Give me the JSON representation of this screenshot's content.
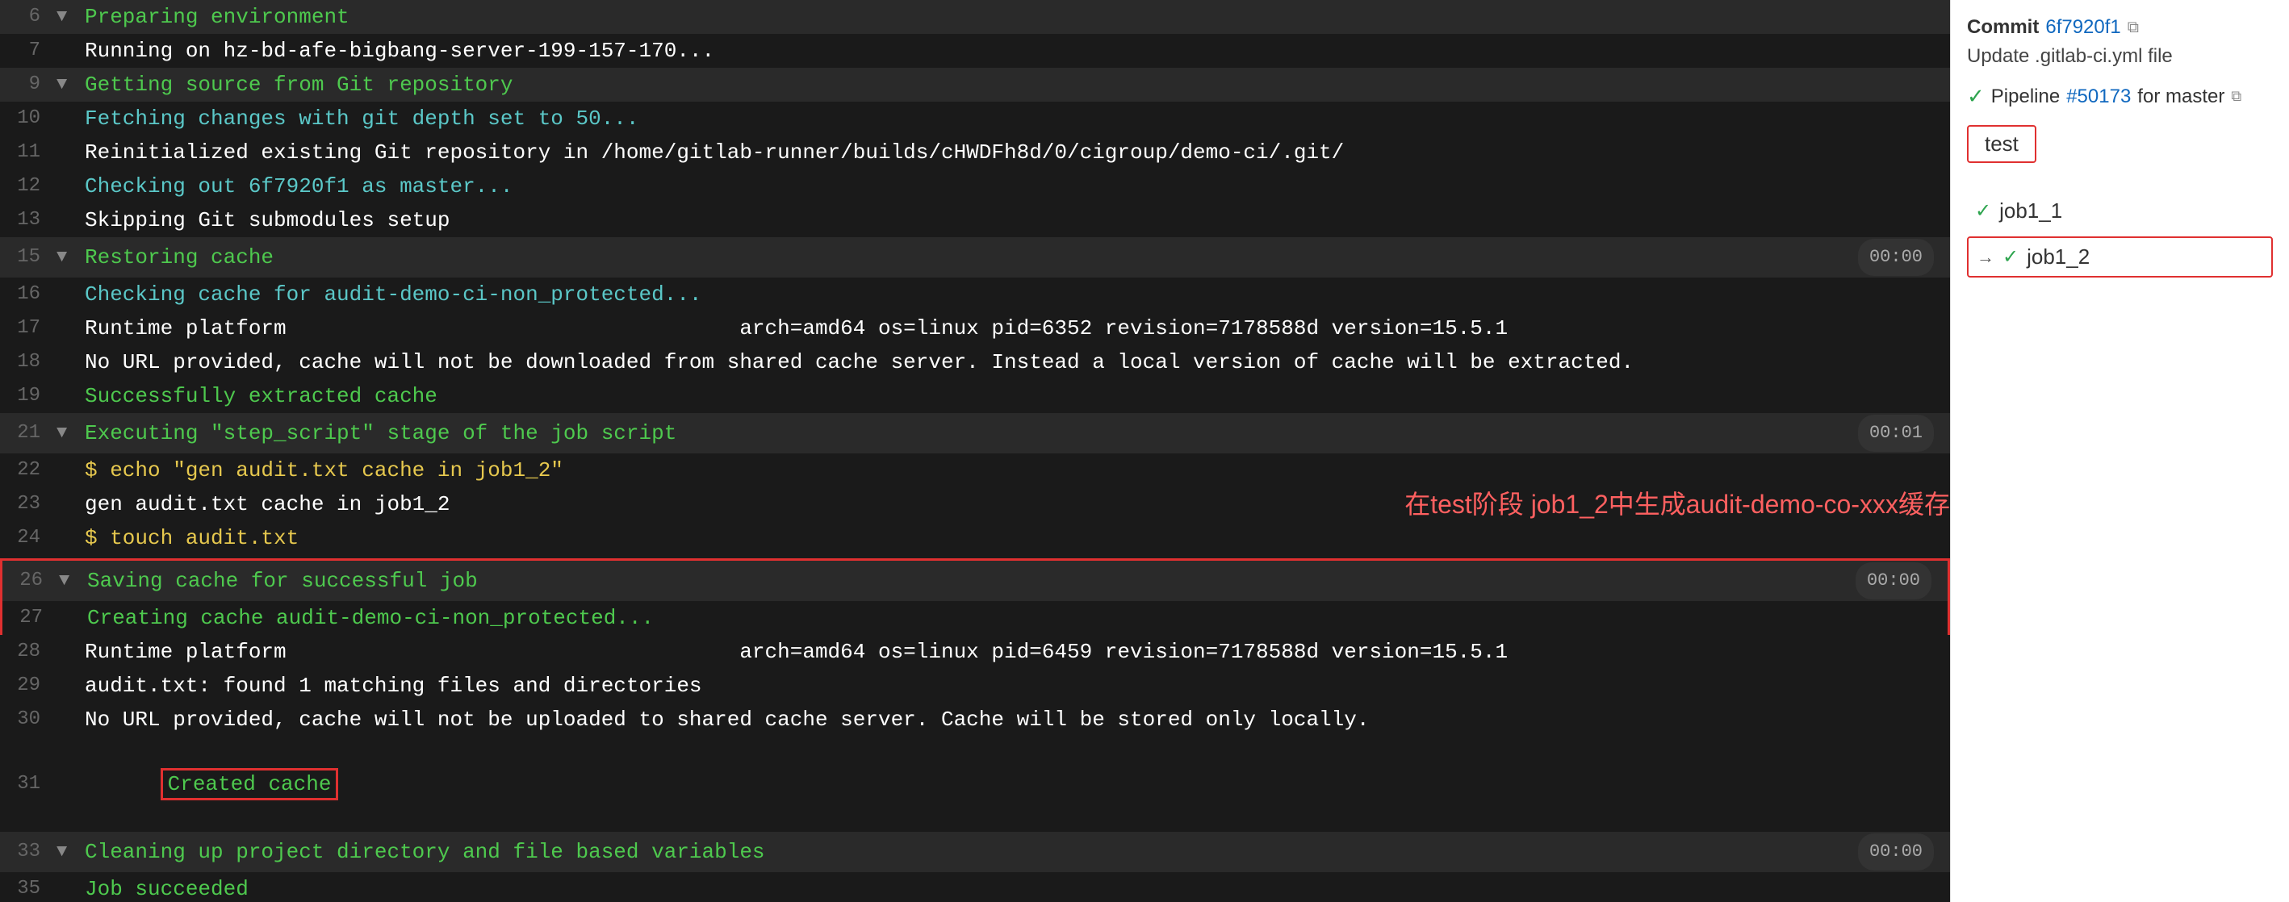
{
  "terminal": {
    "lines": [
      {
        "id": "6",
        "number": "6",
        "type": "section",
        "hasChevron": true,
        "chevronDir": "down",
        "content": "Preparing environment",
        "contentClass": "text-green",
        "timestamp": null
      },
      {
        "id": "7",
        "number": "7",
        "type": "normal",
        "hasChevron": false,
        "content": "Running on hz-bd-afe-bigbang-server-199-157-170...",
        "contentClass": "text-white",
        "timestamp": null
      },
      {
        "id": "9",
        "number": "9",
        "type": "section",
        "hasChevron": true,
        "chevronDir": "down",
        "content": "Getting source from Git repository",
        "contentClass": "text-green",
        "timestamp": null
      },
      {
        "id": "10",
        "number": "10",
        "type": "normal",
        "hasChevron": false,
        "content": "Fetching changes with git depth set to 50...",
        "contentClass": "text-cyan",
        "timestamp": null
      },
      {
        "id": "11",
        "number": "11",
        "type": "normal",
        "hasChevron": false,
        "content": "Reinitialized existing Git repository in /home/gitlab-runner/builds/cHWDFh8d/0/cigroup/demo-ci/.git/",
        "contentClass": "text-white",
        "timestamp": null
      },
      {
        "id": "12",
        "number": "12",
        "type": "normal",
        "hasChevron": false,
        "content": "Checking out 6f7920f1 as master...",
        "contentClass": "text-cyan",
        "timestamp": null
      },
      {
        "id": "13",
        "number": "13",
        "type": "normal",
        "hasChevron": false,
        "content": "Skipping Git submodules setup",
        "contentClass": "text-white",
        "timestamp": null
      },
      {
        "id": "15",
        "number": "15",
        "type": "section",
        "hasChevron": true,
        "chevronDir": "down",
        "content": "Restoring cache",
        "contentClass": "text-green",
        "timestamp": "00:00"
      },
      {
        "id": "16",
        "number": "16",
        "type": "normal",
        "hasChevron": false,
        "content": "Checking cache for audit-demo-ci-non_protected...",
        "contentClass": "text-cyan",
        "timestamp": null
      },
      {
        "id": "17",
        "number": "17",
        "type": "normal",
        "hasChevron": false,
        "content": "Runtime platform                                    arch=amd64 os=linux pid=6352 revision=7178588d version=15.5.1",
        "contentClass": "text-white",
        "timestamp": null
      },
      {
        "id": "18",
        "number": "18",
        "type": "normal",
        "hasChevron": false,
        "content": "No URL provided, cache will not be downloaded from shared cache server. Instead a local version of cache will be extracted.",
        "contentClass": "text-white",
        "timestamp": null
      },
      {
        "id": "19",
        "number": "19",
        "type": "normal",
        "hasChevron": false,
        "content": "Successfully extracted cache",
        "contentClass": "text-green",
        "timestamp": null
      },
      {
        "id": "21",
        "number": "21",
        "type": "section",
        "hasChevron": true,
        "chevronDir": "down",
        "content": "Executing \"step_script\" stage of the job script",
        "contentClass": "text-green",
        "timestamp": "00:01"
      },
      {
        "id": "22",
        "number": "22",
        "type": "normal",
        "hasChevron": false,
        "content": "$ echo \"gen audit.txt cache in job1_2\"",
        "contentClass": "text-yellow",
        "timestamp": null
      },
      {
        "id": "23",
        "number": "23",
        "type": "normal",
        "hasChevron": false,
        "content": "gen audit.txt cache in job1_2",
        "contentClass": "text-white",
        "timestamp": null
      },
      {
        "id": "24",
        "number": "24",
        "type": "normal",
        "hasChevron": false,
        "content": "$ touch audit.txt",
        "contentClass": "text-yellow",
        "timestamp": null
      },
      {
        "id": "26",
        "number": "26",
        "type": "section-box",
        "hasChevron": true,
        "chevronDir": "down",
        "content": "Saving cache for successful job",
        "contentClass": "text-green",
        "timestamp": "00:00",
        "boxed": true
      },
      {
        "id": "27",
        "number": "27",
        "type": "normal-box",
        "hasChevron": false,
        "content": "Creating cache audit-demo-ci-non_protected...",
        "contentClass": "text-green",
        "timestamp": null,
        "boxed": true
      },
      {
        "id": "28",
        "number": "28",
        "type": "normal",
        "hasChevron": false,
        "content": "Runtime platform                                    arch=amd64 os=linux pid=6459 revision=7178588d version=15.5.1",
        "contentClass": "text-white",
        "timestamp": null
      },
      {
        "id": "29",
        "number": "29",
        "type": "normal",
        "hasChevron": false,
        "content": "audit.txt: found 1 matching files and directories",
        "contentClass": "text-white",
        "timestamp": null
      },
      {
        "id": "30",
        "number": "30",
        "type": "normal",
        "hasChevron": false,
        "content": "No URL provided, cache will not be uploaded to shared cache server. Cache will be stored only locally.",
        "contentClass": "text-white",
        "timestamp": null
      },
      {
        "id": "31",
        "number": "31",
        "type": "normal-box",
        "hasChevron": false,
        "content": "Created cache",
        "contentClass": "text-green",
        "timestamp": null,
        "boxed": true
      },
      {
        "id": "33",
        "number": "33",
        "type": "section",
        "hasChevron": true,
        "chevronDir": "down",
        "content": "Cleaning up project directory and file based variables",
        "contentClass": "text-green",
        "timestamp": "00:00"
      },
      {
        "id": "35",
        "number": "35",
        "type": "normal",
        "hasChevron": false,
        "content": "Job succeeded",
        "contentClass": "text-green",
        "timestamp": null
      }
    ],
    "annotation": "在test阶段 job1_2中生成audit-demo-co-xxx缓存"
  },
  "sidebar": {
    "commit_label": "Commit",
    "commit_hash": "6f7920f1",
    "commit_message": "Update .gitlab-ci.yml file",
    "pipeline_label": "Pipeline",
    "pipeline_number": "#50173",
    "pipeline_suffix": "for master",
    "stage_label": "test",
    "jobs": [
      {
        "name": "job1_1",
        "status": "success",
        "active": false
      },
      {
        "name": "job1_2",
        "status": "success",
        "active": true
      }
    ]
  }
}
